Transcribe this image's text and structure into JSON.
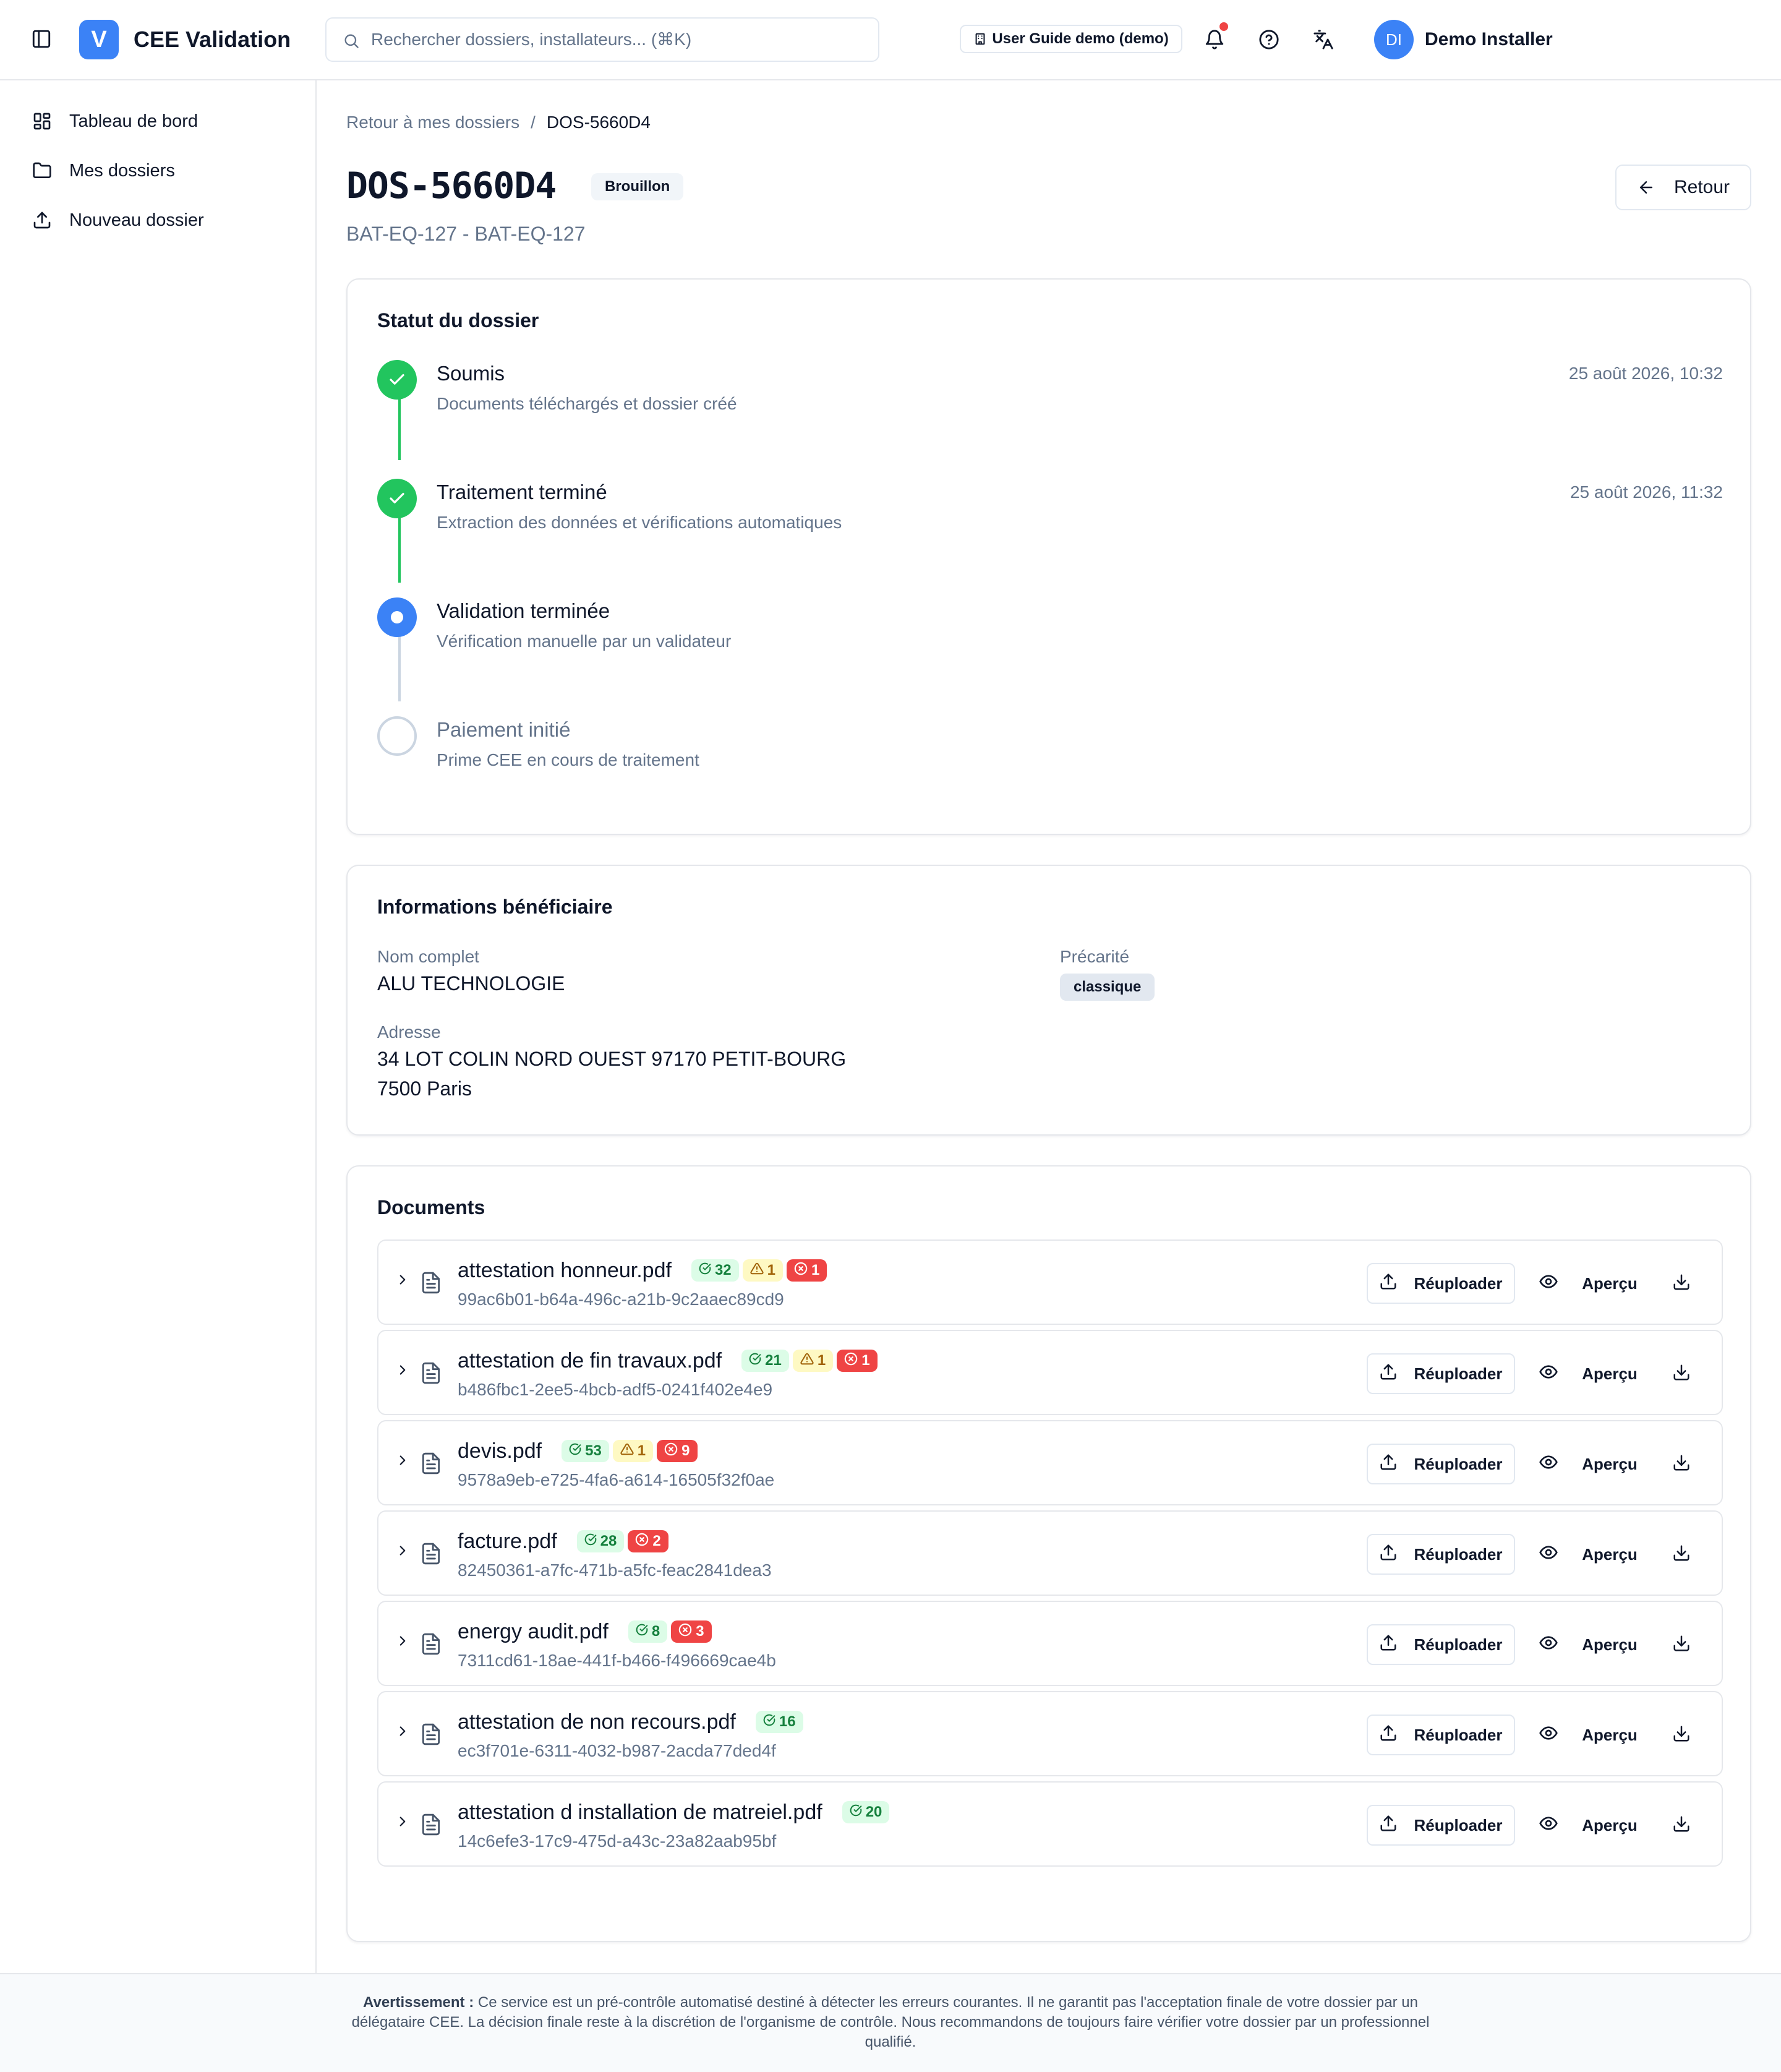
{
  "app": {
    "logo_letter": "V",
    "title": "CEE Validation",
    "accent": "#3b82f6"
  },
  "search": {
    "placeholder": "Rechercher dossiers, installateurs... (⌘K)",
    "value": ""
  },
  "header": {
    "guide_label": "User Guide demo (demo)",
    "guide_icon": "building-icon",
    "avatar_initials": "DI",
    "user_name": "Demo Installer",
    "notification_badge_color": "#ef4444"
  },
  "sidebar": {
    "items": [
      {
        "label": "Tableau de bord",
        "icon": "dashboard-icon"
      },
      {
        "label": "Mes dossiers",
        "icon": "folder-icon"
      },
      {
        "label": "Nouveau dossier",
        "icon": "upload-icon"
      }
    ]
  },
  "breadcrumb": {
    "parent": "Retour à mes dossiers",
    "separator": "/",
    "current": "DOS-5660D4"
  },
  "page": {
    "title": "DOS-5660D4",
    "status_badge": "Brouillon",
    "subtitle": "BAT-EQ-127 - BAT-EQ-127",
    "back_label": "Retour"
  },
  "status_card": {
    "title": "Statut du dossier",
    "steps": [
      {
        "label": "Soumis",
        "description": "Documents téléchargés et dossier créé",
        "date": "25 août 2026, 10:32",
        "state": "done"
      },
      {
        "label": "Traitement terminé",
        "description": "Extraction des données et vérifications automatiques",
        "date": "25 août 2026, 11:32",
        "state": "done"
      },
      {
        "label": "Validation terminée",
        "description": "Vérification manuelle par un validateur",
        "date": "",
        "state": "current"
      },
      {
        "label": "Paiement initié",
        "description": "Prime CEE en cours de traitement",
        "date": "",
        "state": "pending"
      }
    ],
    "colors": {
      "done": "#22c55e",
      "current": "#3b82f6",
      "pending": "#cbd5e1"
    }
  },
  "beneficiary": {
    "title": "Informations bénéficiaire",
    "name_label": "Nom complet",
    "name": "ALU TECHNOLOGIE",
    "precarity_label": "Précarité",
    "precarity": "classique",
    "address_label": "Adresse",
    "address_line1": "34 LOT COLIN NORD OUEST 97170 PETIT-BOURG",
    "address_line2": "7500 Paris"
  },
  "documents": {
    "title": "Documents",
    "reupload_label": "Réuploader",
    "preview_label": "Aperçu",
    "items": [
      {
        "name": "attestation honneur.pdf",
        "id": "99ac6b01-b64a-496c-a21b-9c2aaec89cd9",
        "ok": "32",
        "warn": "1",
        "err": "1"
      },
      {
        "name": "attestation de fin travaux.pdf",
        "id": "b486fbc1-2ee5-4bcb-adf5-0241f402e4e9",
        "ok": "21",
        "warn": "1",
        "err": "1"
      },
      {
        "name": "devis.pdf",
        "id": "9578a9eb-e725-4fa6-a614-16505f32f0ae",
        "ok": "53",
        "warn": "1",
        "err": "9"
      },
      {
        "name": "facture.pdf",
        "id": "82450361-a7fc-471b-a5fc-feac2841dea3",
        "ok": "28",
        "warn": null,
        "err": "2"
      },
      {
        "name": "energy audit.pdf",
        "id": "7311cd61-18ae-441f-b466-f496669cae4b",
        "ok": "8",
        "warn": null,
        "err": "3"
      },
      {
        "name": "attestation de non recours.pdf",
        "id": "ec3f701e-6311-4032-b987-2acda77ded4f",
        "ok": "16",
        "warn": null,
        "err": null
      },
      {
        "name": "attestation d installation de matreiel.pdf",
        "id": "14c6efe3-17c9-475d-a43c-23a82aab95bf",
        "ok": "20",
        "warn": null,
        "err": null
      }
    ]
  },
  "footer": {
    "warning_title": "Avertissement :",
    "warning_text": "Ce service est un pré-contrôle automatisé destiné à détecter les erreurs courantes. Il ne garantit pas l'acceptation finale de votre dossier par un délégataire CEE. La décision finale reste à la discrétion de l'organisme de contrôle. Nous recommandons de toujours faire vérifier votre dossier par un professionnel qualifié."
  }
}
